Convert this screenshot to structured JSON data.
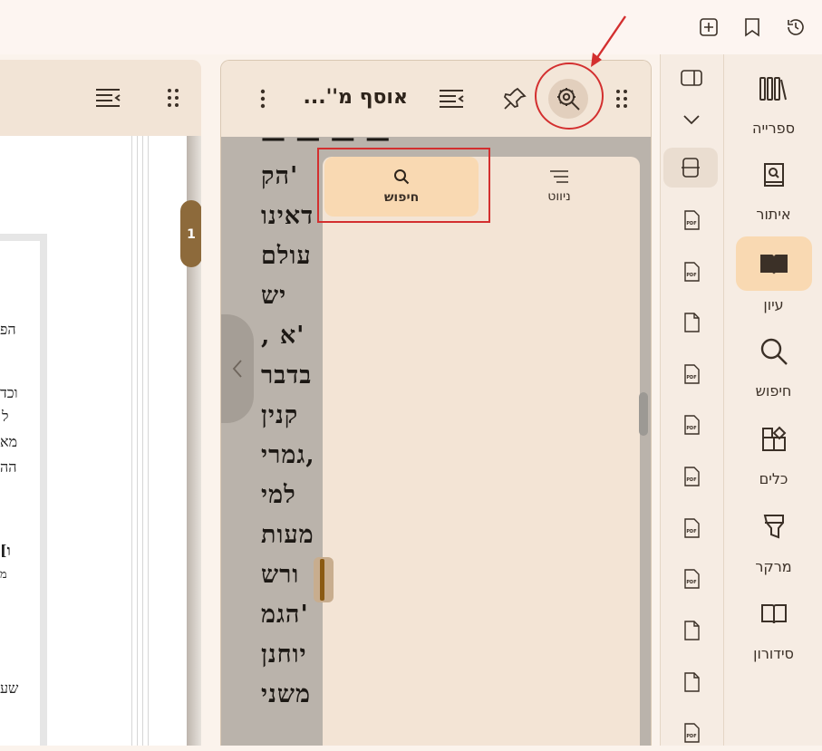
{
  "colors": {
    "accent": "#f9d9b2",
    "annotation_red": "#d32f2f",
    "panel_bg": "#f3e4d5",
    "page_badge": "#8d6a3b"
  },
  "topbar": {
    "icons": [
      "add-tab-icon",
      "bookmark-icon",
      "history-icon"
    ]
  },
  "left_pane": {
    "page_badge": "1",
    "fragments": [
      "הפ",
      "וכד",
      "ל",
      "מא",
      "הה",
      "[ו",
      "מ",
      "שע"
    ]
  },
  "book_pane": {
    "title": "אוסף מ''...",
    "icons": [
      "drag-handle-icon",
      "more-vert-icon",
      "toc-icon",
      "pin-icon",
      "search-settings-icon"
    ],
    "text_lines": [
      "הק'",
      "דאינו",
      "עולם",
      "יש",
      ", א'",
      "בדבר",
      "קנין",
      "גמרי,",
      "למי",
      "מעות",
      "ורש",
      "הגמ'",
      "יוחנן",
      "משני"
    ],
    "side_panel": {
      "tabs": [
        {
          "label": "ניווט",
          "icon": "navigation-icon",
          "active": false
        },
        {
          "label": "חיפוש",
          "icon": "search-icon",
          "active": true
        }
      ]
    }
  },
  "file_strip": {
    "items": [
      "panel-toggle-icon",
      "chevron-down-icon",
      "split-view-icon",
      "pdf-file-icon",
      "pdf-file-icon",
      "file-icon",
      "pdf-file-icon",
      "pdf-file-icon",
      "pdf-file-icon",
      "pdf-file-icon",
      "pdf-file-icon",
      "file-icon",
      "file-icon",
      "pdf-file-icon"
    ],
    "pdf_label": "PDF"
  },
  "nav_rail": {
    "items": [
      {
        "label": "ספרייה",
        "icon": "library-icon",
        "active": false
      },
      {
        "label": "איתור",
        "icon": "find-book-icon",
        "active": false
      },
      {
        "label": "עיון",
        "icon": "reading-icon",
        "active": true
      },
      {
        "label": "חיפוש",
        "icon": "search-icon",
        "active": false
      },
      {
        "label": "כלים",
        "icon": "tools-icon",
        "active": false
      },
      {
        "label": "מרקר",
        "icon": "marker-icon",
        "active": false
      },
      {
        "label": "סידורון",
        "icon": "siddur-icon",
        "active": false
      }
    ]
  }
}
